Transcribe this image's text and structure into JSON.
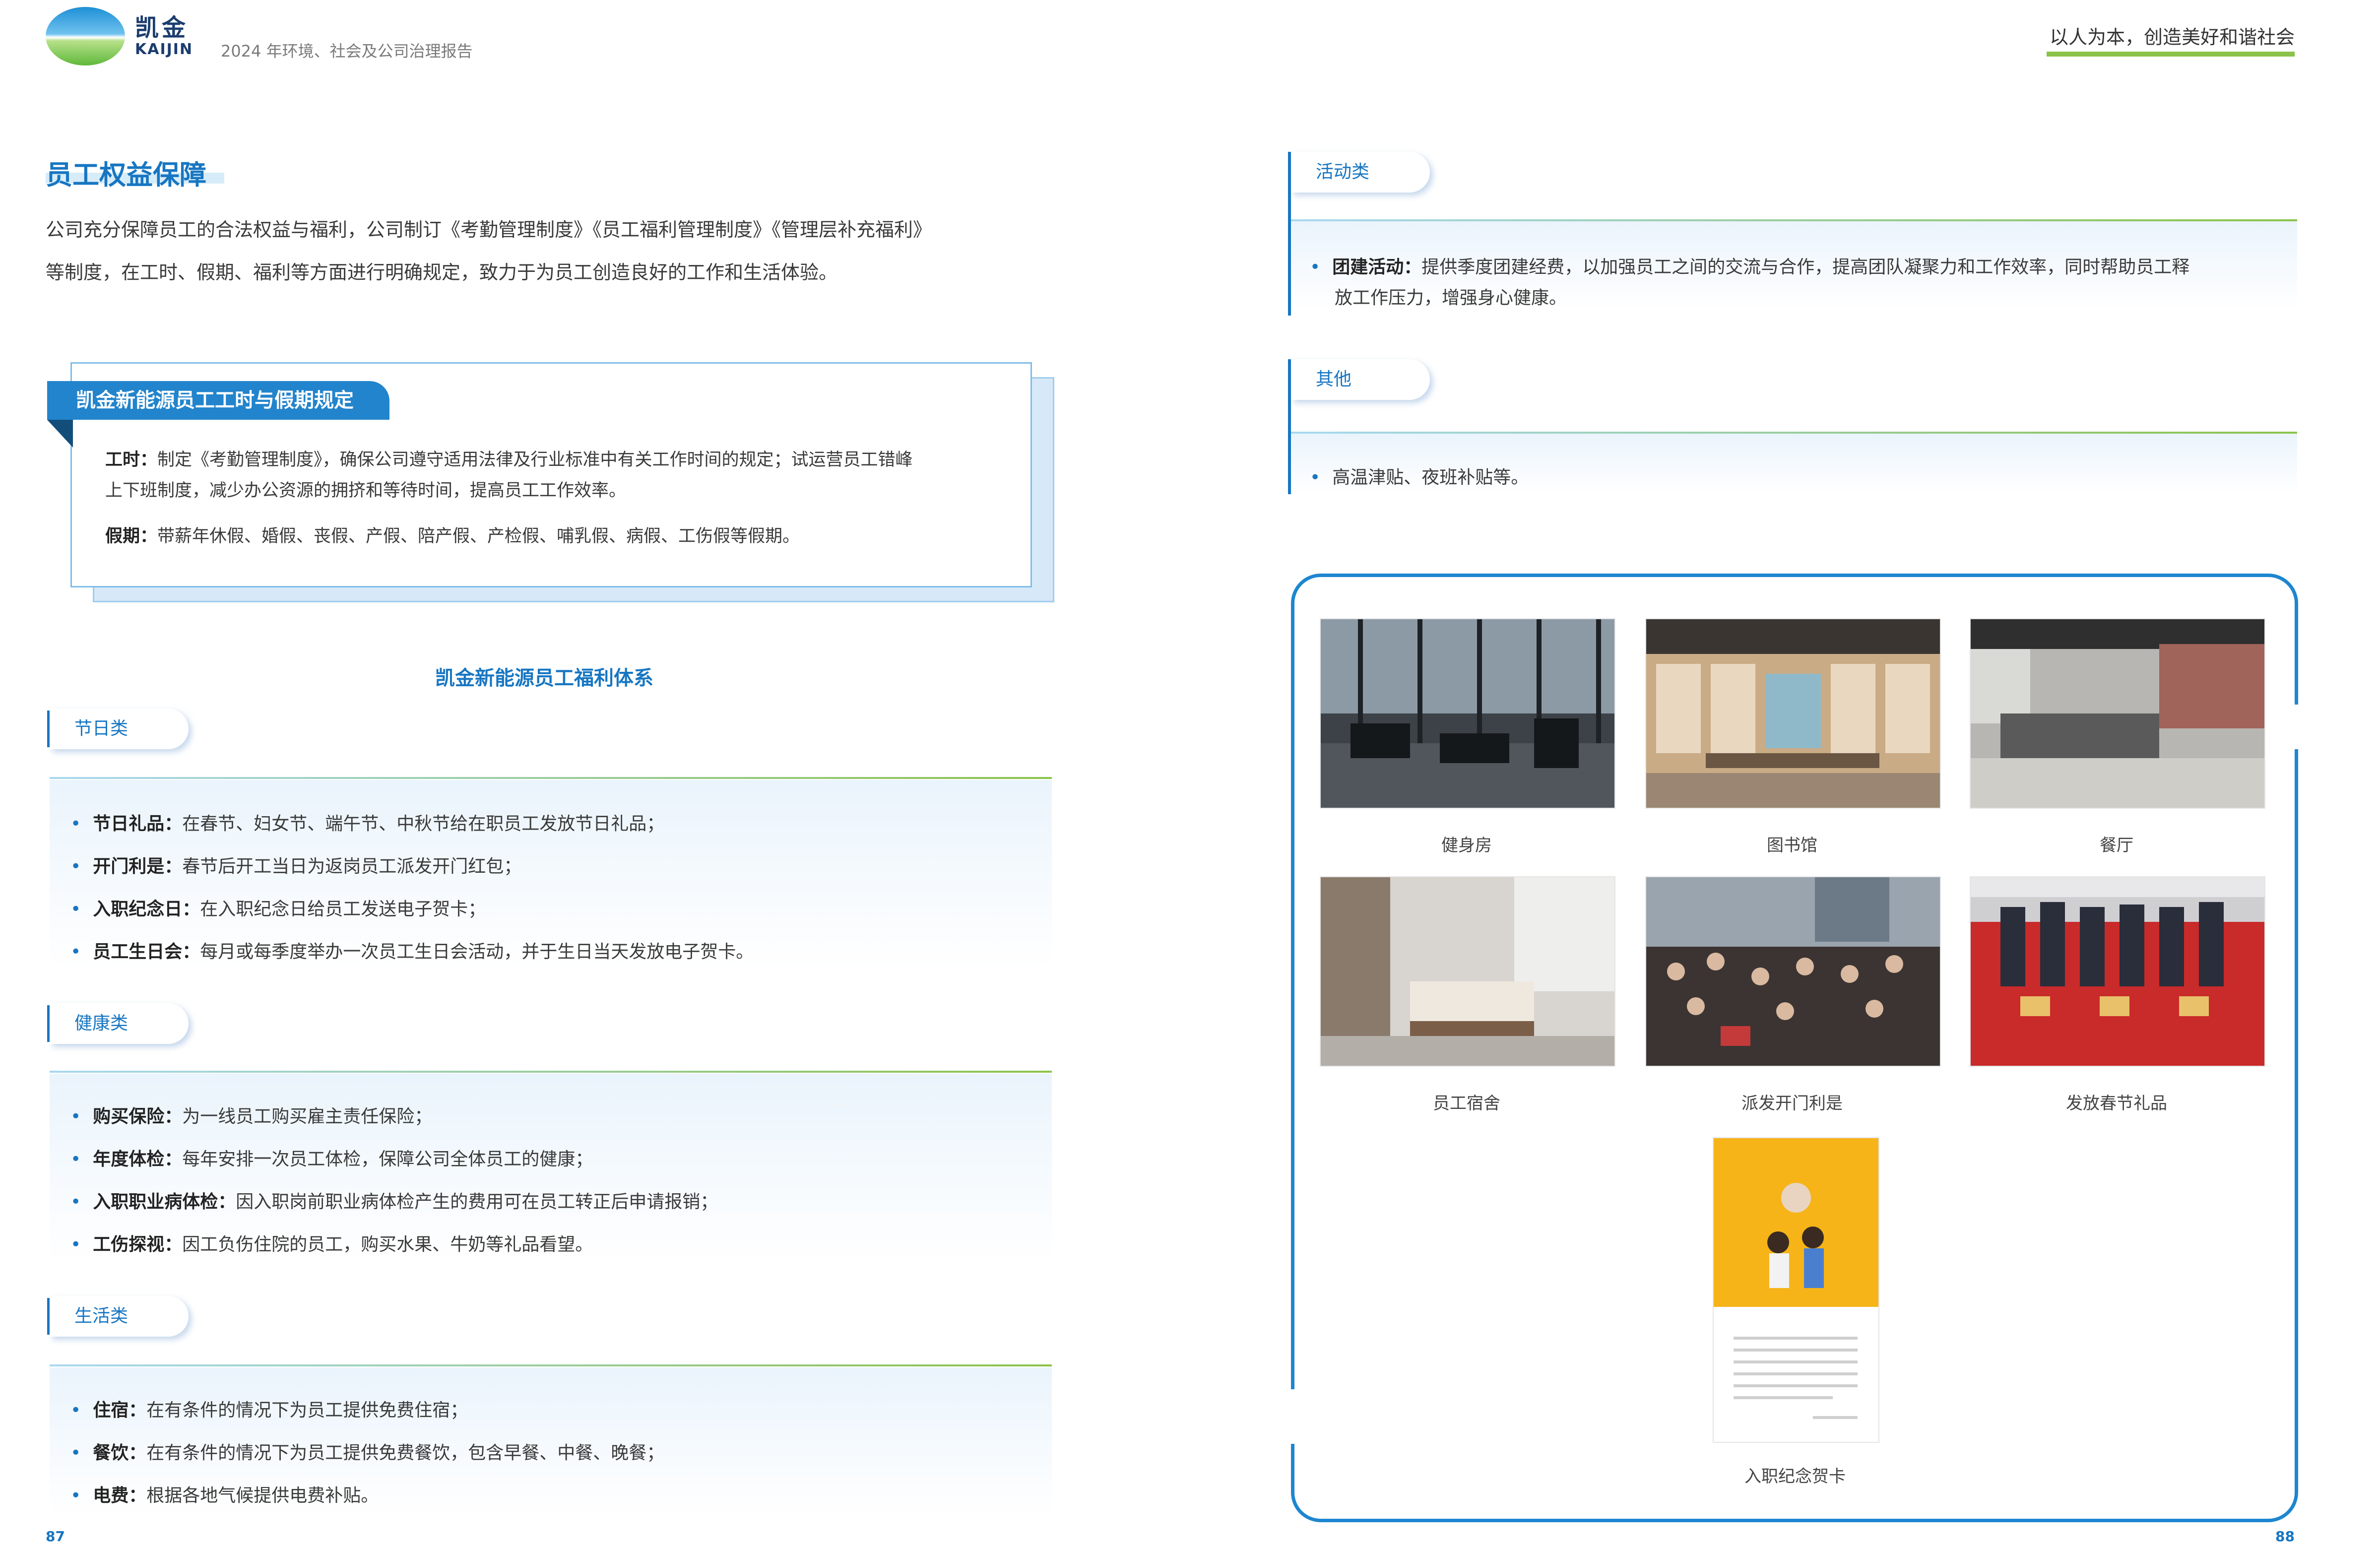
{
  "header": {
    "logo_cn": "凯金",
    "logo_en": "KAIJIN",
    "report_title": "2024 年环境、社会及公司治理报告",
    "slogan": "以人为本，创造美好和谐社会"
  },
  "left": {
    "section_title": "员工权益保障",
    "intro_lines": [
      "公司充分保障员工的合法权益与福利，公司制订《考勤管理制度》《员工福利管理制度》《管理层补充福利》",
      "等制度，在工时、假期、福利等方面进行明确规定，致力于为员工创造良好的工作和生活体验。"
    ],
    "rule_box": {
      "title": "凯金新能源员工工时与假期规定",
      "work_label": "工时：",
      "work_text_1": "制定《考勤管理制度》，确保公司遵守适用法律及行业标准中有关工作时间的规定；试运营员工错峰",
      "work_text_2": "上下班制度，减少办公资源的拥挤和等待时间，提高员工工作效率。",
      "leave_label": "假期：",
      "leave_text": "带薪年休假、婚假、丧假、产假、陪产假、产检假、哺乳假、病假、工伤假等假期。"
    },
    "welfare_title": "凯金新能源员工福利体系",
    "categories": [
      {
        "name": "节日类",
        "items": [
          {
            "label": "节日礼品：",
            "text": "在春节、妇女节、端午节、中秋节给在职员工发放节日礼品；"
          },
          {
            "label": "开门利是：",
            "text": "春节后开工当日为返岗员工派发开门红包；"
          },
          {
            "label": "入职纪念日：",
            "text": "在入职纪念日给员工发送电子贺卡；"
          },
          {
            "label": "员工生日会：",
            "text": "每月或每季度举办一次员工生日会活动，并于生日当天发放电子贺卡。"
          }
        ]
      },
      {
        "name": "健康类",
        "items": [
          {
            "label": "购买保险：",
            "text": "为一线员工购买雇主责任保险；"
          },
          {
            "label": "年度体检：",
            "text": "每年安排一次员工体检，保障公司全体员工的健康；"
          },
          {
            "label": "入职职业病体检：",
            "text": "因入职岗前职业病体检产生的费用可在员工转正后申请报销；"
          },
          {
            "label": "工伤探视：",
            "text": "因工负伤住院的员工，购买水果、牛奶等礼品看望。"
          }
        ]
      },
      {
        "name": "生活类",
        "items": [
          {
            "label": "住宿：",
            "text": "在有条件的情况下为员工提供免费住宿；"
          },
          {
            "label": "餐饮：",
            "text": "在有条件的情况下为员工提供免费餐饮，包含早餐、中餐、晚餐；"
          },
          {
            "label": "电费：",
            "text": "根据各地气候提供电费补贴。"
          }
        ]
      }
    ],
    "page_number": "87"
  },
  "right": {
    "activity": {
      "name": "活动类",
      "label": "团建活动：",
      "text_1": "提供季度团建经费，以加强员工之间的交流与合作，提高团队凝聚力和工作效率，同时帮助员工释",
      "text_2": "放工作压力，增强身心健康。"
    },
    "other": {
      "name": "其他",
      "text": "高温津贴、夜班补贴等。"
    },
    "photos": [
      {
        "caption": "健身房"
      },
      {
        "caption": "图书馆"
      },
      {
        "caption": "餐厅"
      },
      {
        "caption": "员工宿舍"
      },
      {
        "caption": "派发开门利是"
      },
      {
        "caption": "发放春节礼品"
      },
      {
        "caption": "入职纪念贺卡"
      }
    ],
    "page_number": "88"
  },
  "colors": {
    "brand_blue": "#1776c2",
    "accent_green": "#8bc34a",
    "frame_blue": "#1d86d0"
  }
}
